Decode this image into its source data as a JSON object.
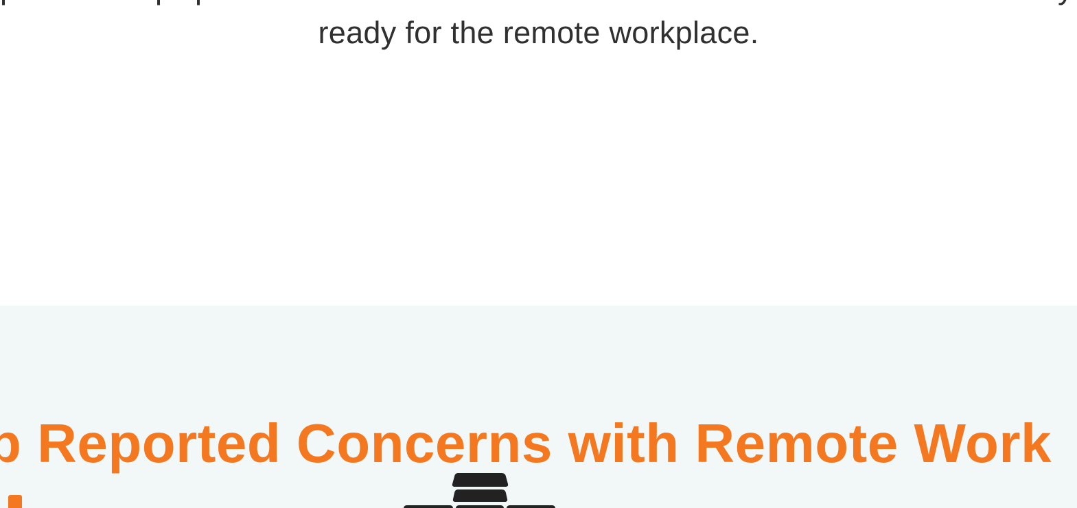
{
  "intro": {
    "cut_line_fragments": [
      "p",
      "p",
      "p",
      "y"
    ],
    "line": "ready for the remote workplace."
  },
  "concerns": {
    "title": "Top Reported Concerns with Remote Work",
    "title_visible": "p Reported Concerns with Remote Work"
  },
  "colors": {
    "accent": "#f47820",
    "section_bg": "#f2f7f7",
    "text": "#303030",
    "icon": "#222222"
  },
  "icons": {
    "chart_stack": "stacked-blocks-icon"
  }
}
